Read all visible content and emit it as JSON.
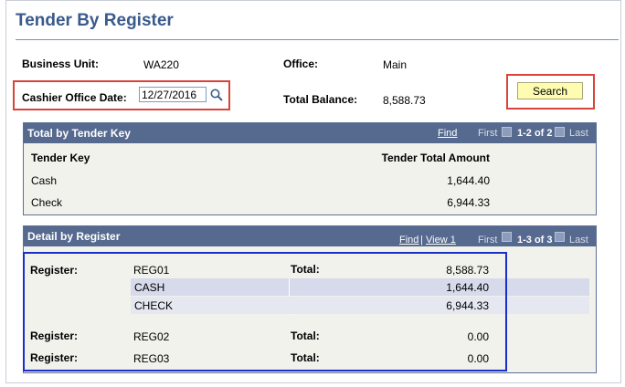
{
  "page": {
    "title": "Tender By Register"
  },
  "header": {
    "business_unit_label": "Business Unit:",
    "business_unit_value": "WA220",
    "office_label": "Office:",
    "office_value": "Main",
    "cashier_date_label": "Cashier Office Date:",
    "cashier_date_value": "12/27/2016",
    "total_balance_label": "Total Balance:",
    "total_balance_value": "8,588.73",
    "search_label": "Search"
  },
  "tender_grid": {
    "title": "Total by Tender Key",
    "find": "Find",
    "first": "First",
    "range": "1-2 of 2",
    "last": "Last",
    "col_key": "Tender Key",
    "col_amount": "Tender Total Amount",
    "rows": [
      {
        "key": "Cash",
        "amount": "1,644.40"
      },
      {
        "key": "Check",
        "amount": "6,944.33"
      }
    ]
  },
  "register_grid": {
    "title": "Detail by Register",
    "find": "Find",
    "sep": "|",
    "view": "View 1",
    "first": "First",
    "range": "1-3 of 3",
    "last": "Last",
    "register_label": "Register:",
    "total_label": "Total:",
    "registers": [
      {
        "id": "REG01",
        "total": "8,588.73",
        "details": [
          {
            "type": "CASH",
            "amount": "1,644.40"
          },
          {
            "type": "CHECK",
            "amount": "6,944.33"
          }
        ]
      },
      {
        "id": "REG02",
        "total": "0.00"
      },
      {
        "id": "REG03",
        "total": "0.00"
      }
    ]
  }
}
